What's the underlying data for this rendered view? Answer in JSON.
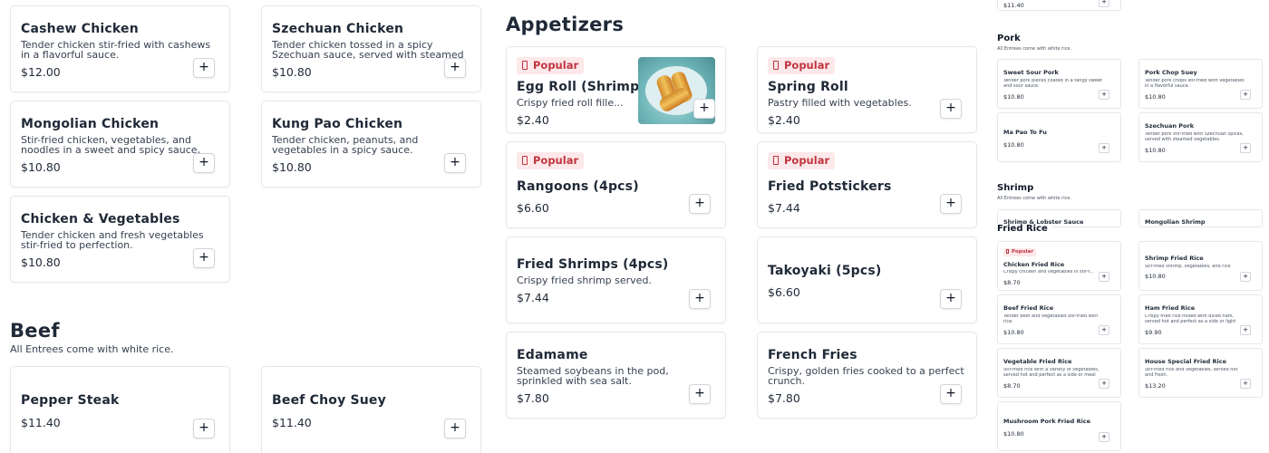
{
  "colors": {
    "accent": "#c0353f",
    "popular_bg": "#fde8ea",
    "border": "#e5e7eb"
  },
  "popular_label": "Popular",
  "add_icon": "plus-icon",
  "chicken": [
    {
      "name": "Cashew Chicken",
      "desc": "Tender chicken stir-fried with cashews in a flavorful sauce.",
      "price": "$12.00"
    },
    {
      "name": "Szechuan Chicken",
      "desc": "Tender chicken tossed in a spicy Szechuan sauce, served with steamed vegetables.",
      "price": "$10.80"
    },
    {
      "name": "Mongolian Chicken",
      "desc": "Stir-fried chicken, vegetables, and noodles in a sweet and spicy sauce, served hot.",
      "price": "$10.80"
    },
    {
      "name": "Kung Pao Chicken",
      "desc": "Tender chicken, peanuts, and vegetables in a spicy sauce.",
      "price": "$10.80"
    },
    {
      "name": "Chicken & Vegetables",
      "desc": "Tender chicken and fresh vegetables stir-fried to perfection.",
      "price": "$10.80"
    }
  ],
  "beef": {
    "title": "Beef",
    "subtitle": "All Entrees come with white rice.",
    "items": [
      {
        "name": "Pepper Steak",
        "price": "$11.40"
      },
      {
        "name": "Beef Choy Suey",
        "price": "$11.40"
      }
    ]
  },
  "appetizers": {
    "title": "Appetizers",
    "items": [
      {
        "name": "Egg Roll (Shrimp)",
        "desc": "Crispy fried roll fille...",
        "price": "$2.40",
        "popular": true
      },
      {
        "name": "Spring Roll",
        "desc": "Pastry filled with vegetables.",
        "price": "$2.40",
        "popular": true
      },
      {
        "name": "Rangoons (4pcs)",
        "desc": "",
        "price": "$6.60",
        "popular": true
      },
      {
        "name": "Fried Potstickers",
        "desc": "",
        "price": "$7.44",
        "popular": true
      },
      {
        "name": "Fried Shrimps (4pcs)",
        "desc": "Crispy fried shrimp served.",
        "price": "$7.44"
      },
      {
        "name": "Takoyaki (5pcs)",
        "desc": "",
        "price": "$6.60"
      },
      {
        "name": "Edamame",
        "desc": "Steamed soybeans in the pod, sprinkled with sea salt.",
        "price": "$7.80"
      },
      {
        "name": "French Fries",
        "desc": "Crispy, golden fries cooked to a perfect crunch.",
        "price": "$7.80"
      }
    ]
  },
  "mini": {
    "top_price": "$11.40",
    "pork": {
      "title": "Pork",
      "subtitle": "All Entrees come with white rice.",
      "items": [
        {
          "name": "Sweet Sour Pork",
          "desc": "Tender pork pieces coated in a tangy sweet and sour sauce.",
          "price": "$10.80"
        },
        {
          "name": "Pork Chop Suey",
          "desc": "Tender pork chops stir-fried with vegetables in a flavorful sauce.",
          "price": "$10.80"
        },
        {
          "name": "Ma Pao To Fu",
          "desc": "",
          "price": "$10.80"
        },
        {
          "name": "Szechuan Pork",
          "desc": "Tender pork stir-fried with Szechuan spices, served with steamed vegetables.",
          "price": "$10.80"
        }
      ]
    },
    "shrimp": {
      "title": "Shrimp",
      "subtitle": "All Entrees come with white rice.",
      "items": [
        {
          "name": "Shrimp & Lobster Sauce"
        },
        {
          "name": "Mongolian Shrimp"
        }
      ]
    },
    "fried_rice": {
      "title": "Fried Rice",
      "items": [
        {
          "name": "Chicken Fried Rice",
          "desc": "Crispy chicken and vegetables in stir-f...",
          "price": "$8.70",
          "popular": true
        },
        {
          "name": "Shrimp Fried Rice",
          "desc": "Stir-fried shrimp, vegetables, and rice",
          "price": "$10.80"
        },
        {
          "name": "Beef Fried Rice",
          "desc": "Tender beef and vegetables stir-fried with rice.",
          "price": "$10.80"
        },
        {
          "name": "Ham Fried Rice",
          "desc": "Crispy fried rice mixed with diced ham, served hot and perfect as a side or light",
          "price": "$9.90"
        },
        {
          "name": "Vegetable Fried Rice",
          "desc": "Stir-fried rice with a variety of vegetables, served hot and perfect as a side or meal",
          "price": "$8.70"
        },
        {
          "name": "House Special Fried Rice",
          "desc": "Stir-fried rice and vegetables, served hot and fresh.",
          "price": "$13.20"
        },
        {
          "name": "Mushroom Pork Fried Rice",
          "desc": "",
          "price": "$10.80"
        }
      ]
    }
  }
}
